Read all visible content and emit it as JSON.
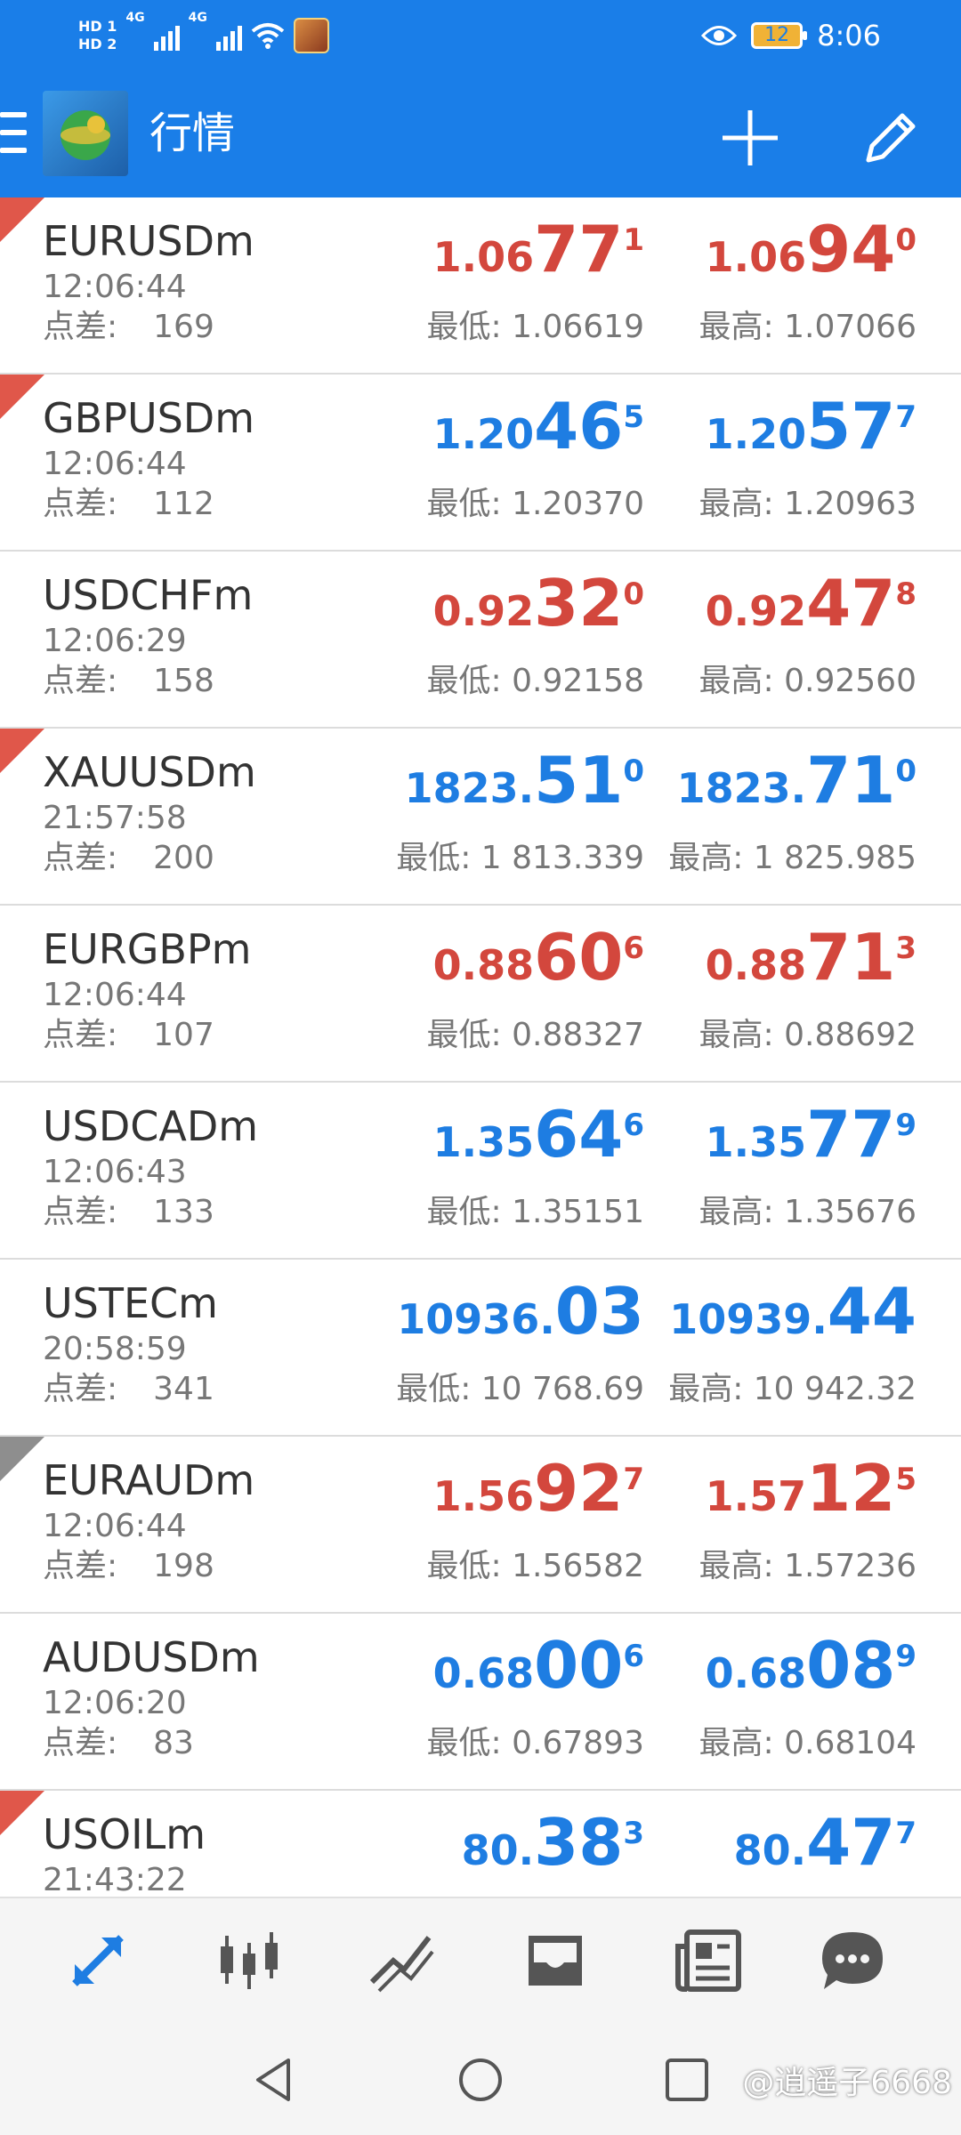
{
  "status_bar": {
    "network": [
      "HD 1",
      "HD 2"
    ],
    "signal_labels": [
      "4G",
      "4G"
    ],
    "battery": "12",
    "time": "8:06",
    "icons": [
      "signal-icon",
      "wifi-icon",
      "game-icon",
      "eye-icon",
      "battery-icon"
    ]
  },
  "app_bar": {
    "title": "行情",
    "icons": [
      "menu-icon",
      "app-logo",
      "plus-icon",
      "pencil-icon"
    ]
  },
  "quotes": [
    {
      "symbol": "EURUSDm",
      "time": "12:06:44",
      "spread_label": "点差:",
      "spread": "169",
      "color": "red",
      "marker": "red",
      "bid": {
        "small": "1.06",
        "big": "77",
        "sup": "1"
      },
      "ask": {
        "small": "1.06",
        "big": "94",
        "sup": "0"
      },
      "low": "最低: 1.06619",
      "high": "最高: 1.07066"
    },
    {
      "symbol": "GBPUSDm",
      "time": "12:06:44",
      "spread_label": "点差:",
      "spread": "112",
      "color": "blue",
      "marker": "red",
      "bid": {
        "small": "1.20",
        "big": "46",
        "sup": "5"
      },
      "ask": {
        "small": "1.20",
        "big": "57",
        "sup": "7"
      },
      "low": "最低: 1.20370",
      "high": "最高: 1.20963"
    },
    {
      "symbol": "USDCHFm",
      "time": "12:06:29",
      "spread_label": "点差:",
      "spread": "158",
      "color": "red",
      "marker": "",
      "bid": {
        "small": "0.92",
        "big": "32",
        "sup": "0"
      },
      "ask": {
        "small": "0.92",
        "big": "47",
        "sup": "8"
      },
      "low": "最低: 0.92158",
      "high": "最高: 0.92560"
    },
    {
      "symbol": "XAUUSDm",
      "time": "21:57:58",
      "spread_label": "点差:",
      "spread": "200",
      "color": "blue",
      "marker": "red",
      "bid": {
        "small": "1823.",
        "big": "51",
        "sup": "0"
      },
      "ask": {
        "small": "1823.",
        "big": "71",
        "sup": "0"
      },
      "low": "最低: 1 813.339",
      "high": "最高: 1 825.985"
    },
    {
      "symbol": "EURGBPm",
      "time": "12:06:44",
      "spread_label": "点差:",
      "spread": "107",
      "color": "red",
      "marker": "",
      "bid": {
        "small": "0.88",
        "big": "60",
        "sup": "6"
      },
      "ask": {
        "small": "0.88",
        "big": "71",
        "sup": "3"
      },
      "low": "最低: 0.88327",
      "high": "最高: 0.88692"
    },
    {
      "symbol": "USDCADm",
      "time": "12:06:43",
      "spread_label": "点差:",
      "spread": "133",
      "color": "blue",
      "marker": "",
      "bid": {
        "small": "1.35",
        "big": "64",
        "sup": "6"
      },
      "ask": {
        "small": "1.35",
        "big": "77",
        "sup": "9"
      },
      "low": "最低: 1.35151",
      "high": "最高: 1.35676"
    },
    {
      "symbol": "USTECm",
      "time": "20:58:59",
      "spread_label": "点差:",
      "spread": "341",
      "color": "blue",
      "marker": "",
      "bid": {
        "small": "10936.",
        "big": "03",
        "sup": ""
      },
      "ask": {
        "small": "10939.",
        "big": "44",
        "sup": ""
      },
      "low": "最低: 10 768.69",
      "high": "最高: 10 942.32"
    },
    {
      "symbol": "EURAUDm",
      "time": "12:06:44",
      "spread_label": "点差:",
      "spread": "198",
      "color": "red",
      "marker": "gray",
      "bid": {
        "small": "1.56",
        "big": "92",
        "sup": "7"
      },
      "ask": {
        "small": "1.57",
        "big": "12",
        "sup": "5"
      },
      "low": "最低: 1.56582",
      "high": "最高: 1.57236"
    },
    {
      "symbol": "AUDUSDm",
      "time": "12:06:20",
      "spread_label": "点差:",
      "spread": "83",
      "color": "blue",
      "marker": "",
      "bid": {
        "small": "0.68",
        "big": "00",
        "sup": "6"
      },
      "ask": {
        "small": "0.68",
        "big": "08",
        "sup": "9"
      },
      "low": "最低: 0.67893",
      "high": "最高: 0.68104"
    },
    {
      "symbol": "USOILm",
      "time": "21:43:22",
      "spread_label": "",
      "spread": "",
      "color": "blue",
      "marker": "red",
      "bid": {
        "small": "80.",
        "big": "38",
        "sup": "3"
      },
      "ask": {
        "small": "80.",
        "big": "47",
        "sup": "7"
      },
      "low": "",
      "high": ""
    }
  ],
  "bottom_nav": [
    "quotes-arrows-icon",
    "candlestick-chart-icon",
    "trade-icon",
    "inbox-icon",
    "news-icon",
    "chat-icon"
  ],
  "system_nav": [
    "back-icon",
    "home-icon",
    "recents-icon"
  ],
  "watermark": "@逍遥子6668",
  "colors": {
    "primary": "#1a7ee8",
    "up": "#1e7de2",
    "down": "#d3473d",
    "marker_red": "#e0574a",
    "marker_gray": "#8e8e8e"
  }
}
